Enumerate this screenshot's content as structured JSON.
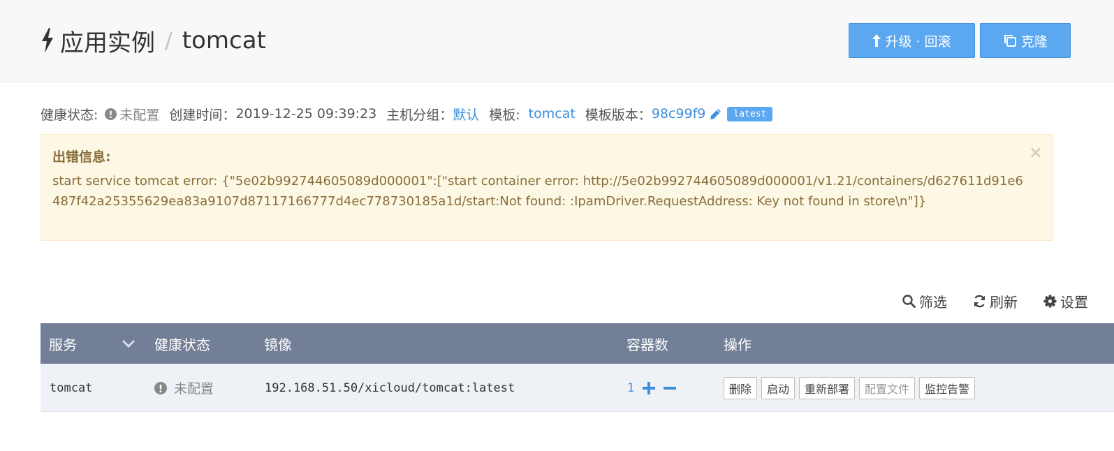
{
  "header": {
    "section": "应用实例",
    "separator": "/",
    "app_name": "tomcat",
    "upgrade_label": "升级 · 回滚",
    "clone_label": "克隆"
  },
  "meta": {
    "health_label": "健康状态:",
    "health_value": "未配置",
    "created_label": "创建时间：",
    "created_value": "2019-12-25 09:39:23",
    "group_label": "主机分组：",
    "group_value": "默认",
    "template_label": "模板:",
    "template_value": "tomcat",
    "template_version_label": "模板版本：",
    "template_version_value": "98c99f9",
    "version_badge": "latest"
  },
  "alert": {
    "title": "出错信息:",
    "message": "start service tomcat error: {\"5e02b992744605089d000001\":[\"start container error: http://5e02b992744605089d000001/v1.21/containers/d627611d91e6487f42a25355629ea83a9107d87117166777d4ec778730185a1d/start:Not found: :IpamDriver.RequestAddress: Key not found in store\\n\"]}",
    "close": "×"
  },
  "toolbar": {
    "filter": "筛选",
    "refresh": "刷新",
    "settings": "设置"
  },
  "table": {
    "columns": [
      "服务",
      "健康状态",
      "镜像",
      "容器数",
      "操作"
    ],
    "rows": [
      {
        "service": "tomcat",
        "health": "未配置",
        "image": "192.168.51.50/xicloud/tomcat:latest",
        "count": "1",
        "actions": [
          "删除",
          "启动",
          "重新部署",
          "配置文件",
          "监控告警"
        ]
      }
    ]
  },
  "colors": {
    "accent": "#5ba8f0",
    "link": "#3d8fe0",
    "table_header": "#737f97",
    "alert_bg": "#fcf8e3",
    "alert_text": "#8a6d3b"
  },
  "icons": {
    "title": "bolt-icon",
    "upgrade": "arrow-up-icon",
    "clone": "copy-icon",
    "health": "exclamation-circle-icon",
    "edit": "pencil-icon",
    "filter": "search-icon",
    "refresh": "refresh-icon",
    "settings": "gear-icon",
    "sort": "chevron-down-icon",
    "increase": "plus-icon",
    "decrease": "minus-icon"
  }
}
